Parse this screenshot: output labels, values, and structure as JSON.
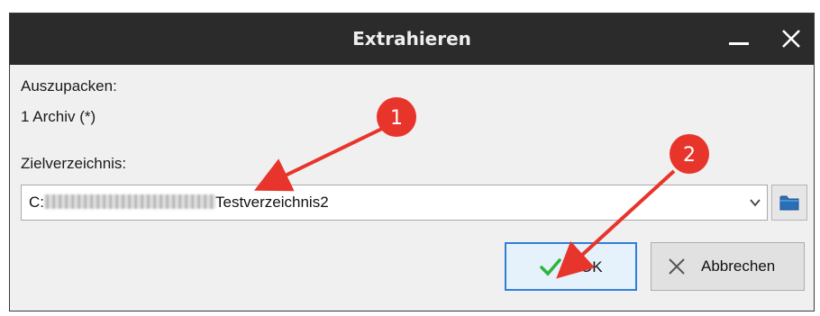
{
  "window": {
    "title": "Extrahieren",
    "minimize_icon": "minimize-icon",
    "close_icon": "close-icon"
  },
  "source": {
    "label": "Auszupacken:",
    "value": "1 Archiv (*)"
  },
  "target": {
    "label": "Zielverzeichnis:",
    "path_prefix": "C:",
    "path_suffix": "Testverzeichnis2",
    "dropdown_icon": "chevron-down-icon",
    "browse_icon": "folder-icon"
  },
  "buttons": {
    "ok_label": "OK",
    "ok_icon": "checkmark-icon",
    "cancel_label": "Abbrechen",
    "cancel_icon": "cross-icon"
  },
  "annotations": {
    "badge_1": "1",
    "badge_2": "2",
    "badge_color": "#e8352b"
  }
}
